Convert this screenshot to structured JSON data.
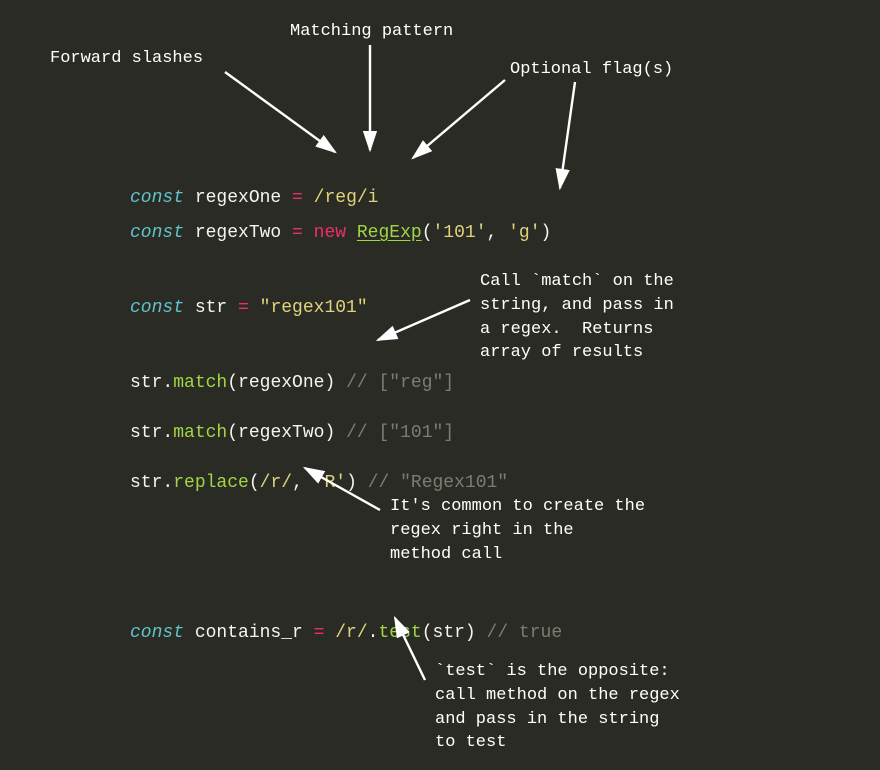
{
  "annotations": {
    "forwardSlashes": "Forward slashes",
    "matchingPattern": "Matching pattern",
    "optionalFlags": "Optional flag(s)",
    "callMatch": "Call `match` on the\nstring, and pass in\na regex.  Returns\narray of results",
    "inlineRegex": "It's common to create the\nregex right in the\nmethod call",
    "testOpposite": "`test` is the opposite:\ncall method on the regex\nand pass in the string\nto test"
  },
  "code": {
    "line1": {
      "const": "const",
      "var": " regexOne ",
      "eq": "=",
      "regex": " /reg/i"
    },
    "line2": {
      "const": "const",
      "var": " regexTwo ",
      "eq": "=",
      "new": " new ",
      "class": "RegExp",
      "open": "(",
      "arg1": "'101'",
      "comma": ", ",
      "arg2": "'g'",
      "close": ")"
    },
    "line3": {
      "const": "const",
      "var": " str ",
      "eq": "=",
      "string": " \"regex101\""
    },
    "line4": {
      "obj": "str.",
      "method": "match",
      "open": "(",
      "arg": "regexOne",
      "close": ") ",
      "comment": "// [\"reg\"]"
    },
    "line5": {
      "obj": "str.",
      "method": "match",
      "open": "(",
      "arg": "regexTwo",
      "close": ") ",
      "comment": "// [\"101\"]"
    },
    "line6": {
      "obj": "str.",
      "method": "replace",
      "open": "(",
      "regex": "/r/",
      "comma": ", ",
      "arg2": "'R'",
      "close": ") ",
      "comment": "// \"Regex101\""
    },
    "line7": {
      "const": "const",
      "var": " contains_r ",
      "eq": "=",
      "regex": " /r/",
      "dot": ".",
      "method": "test",
      "open": "(",
      "arg": "str",
      "close": ") ",
      "comment": "// true"
    }
  }
}
